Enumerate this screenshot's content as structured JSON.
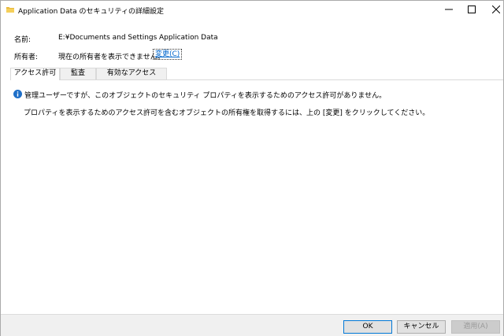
{
  "window": {
    "title": "Application Data のセキュリティの詳細設定",
    "icon": "folder-icon",
    "controls": {
      "minimize": "minimize-icon",
      "maximize": "maximize-icon",
      "close": "close-icon"
    }
  },
  "info": {
    "name_label": "名前:",
    "name_path": "E:¥Documents and Settings",
    "name_file": "Application Data",
    "owner_label": "所有者:",
    "owner_value": "現在の所有者を表示できません。",
    "change_link": "変更(C)"
  },
  "tabs": [
    {
      "label": "アクセス許可",
      "active": true
    },
    {
      "label": "監査",
      "active": false
    },
    {
      "label": "有効なアクセス",
      "active": false
    }
  ],
  "messages": {
    "info_icon": "info-icon",
    "admin": "管理ユーザーですが、このオブジェクトのセキュリティ プロパティを表示するためのアクセス許可がありません。",
    "detail": "プロパティを表示するためのアクセス許可を含むオブジェクトの所有権を取得するには、上の [変更] をクリックしてください。"
  },
  "buttons": {
    "ok": "OK",
    "cancel": "キャンセル",
    "apply": "適用(A)"
  },
  "colors": {
    "link": "#0066cc",
    "info_blue": "#1e6fc8",
    "folder_yellow": "#e8b93c",
    "ok_border": "#0078d7"
  }
}
